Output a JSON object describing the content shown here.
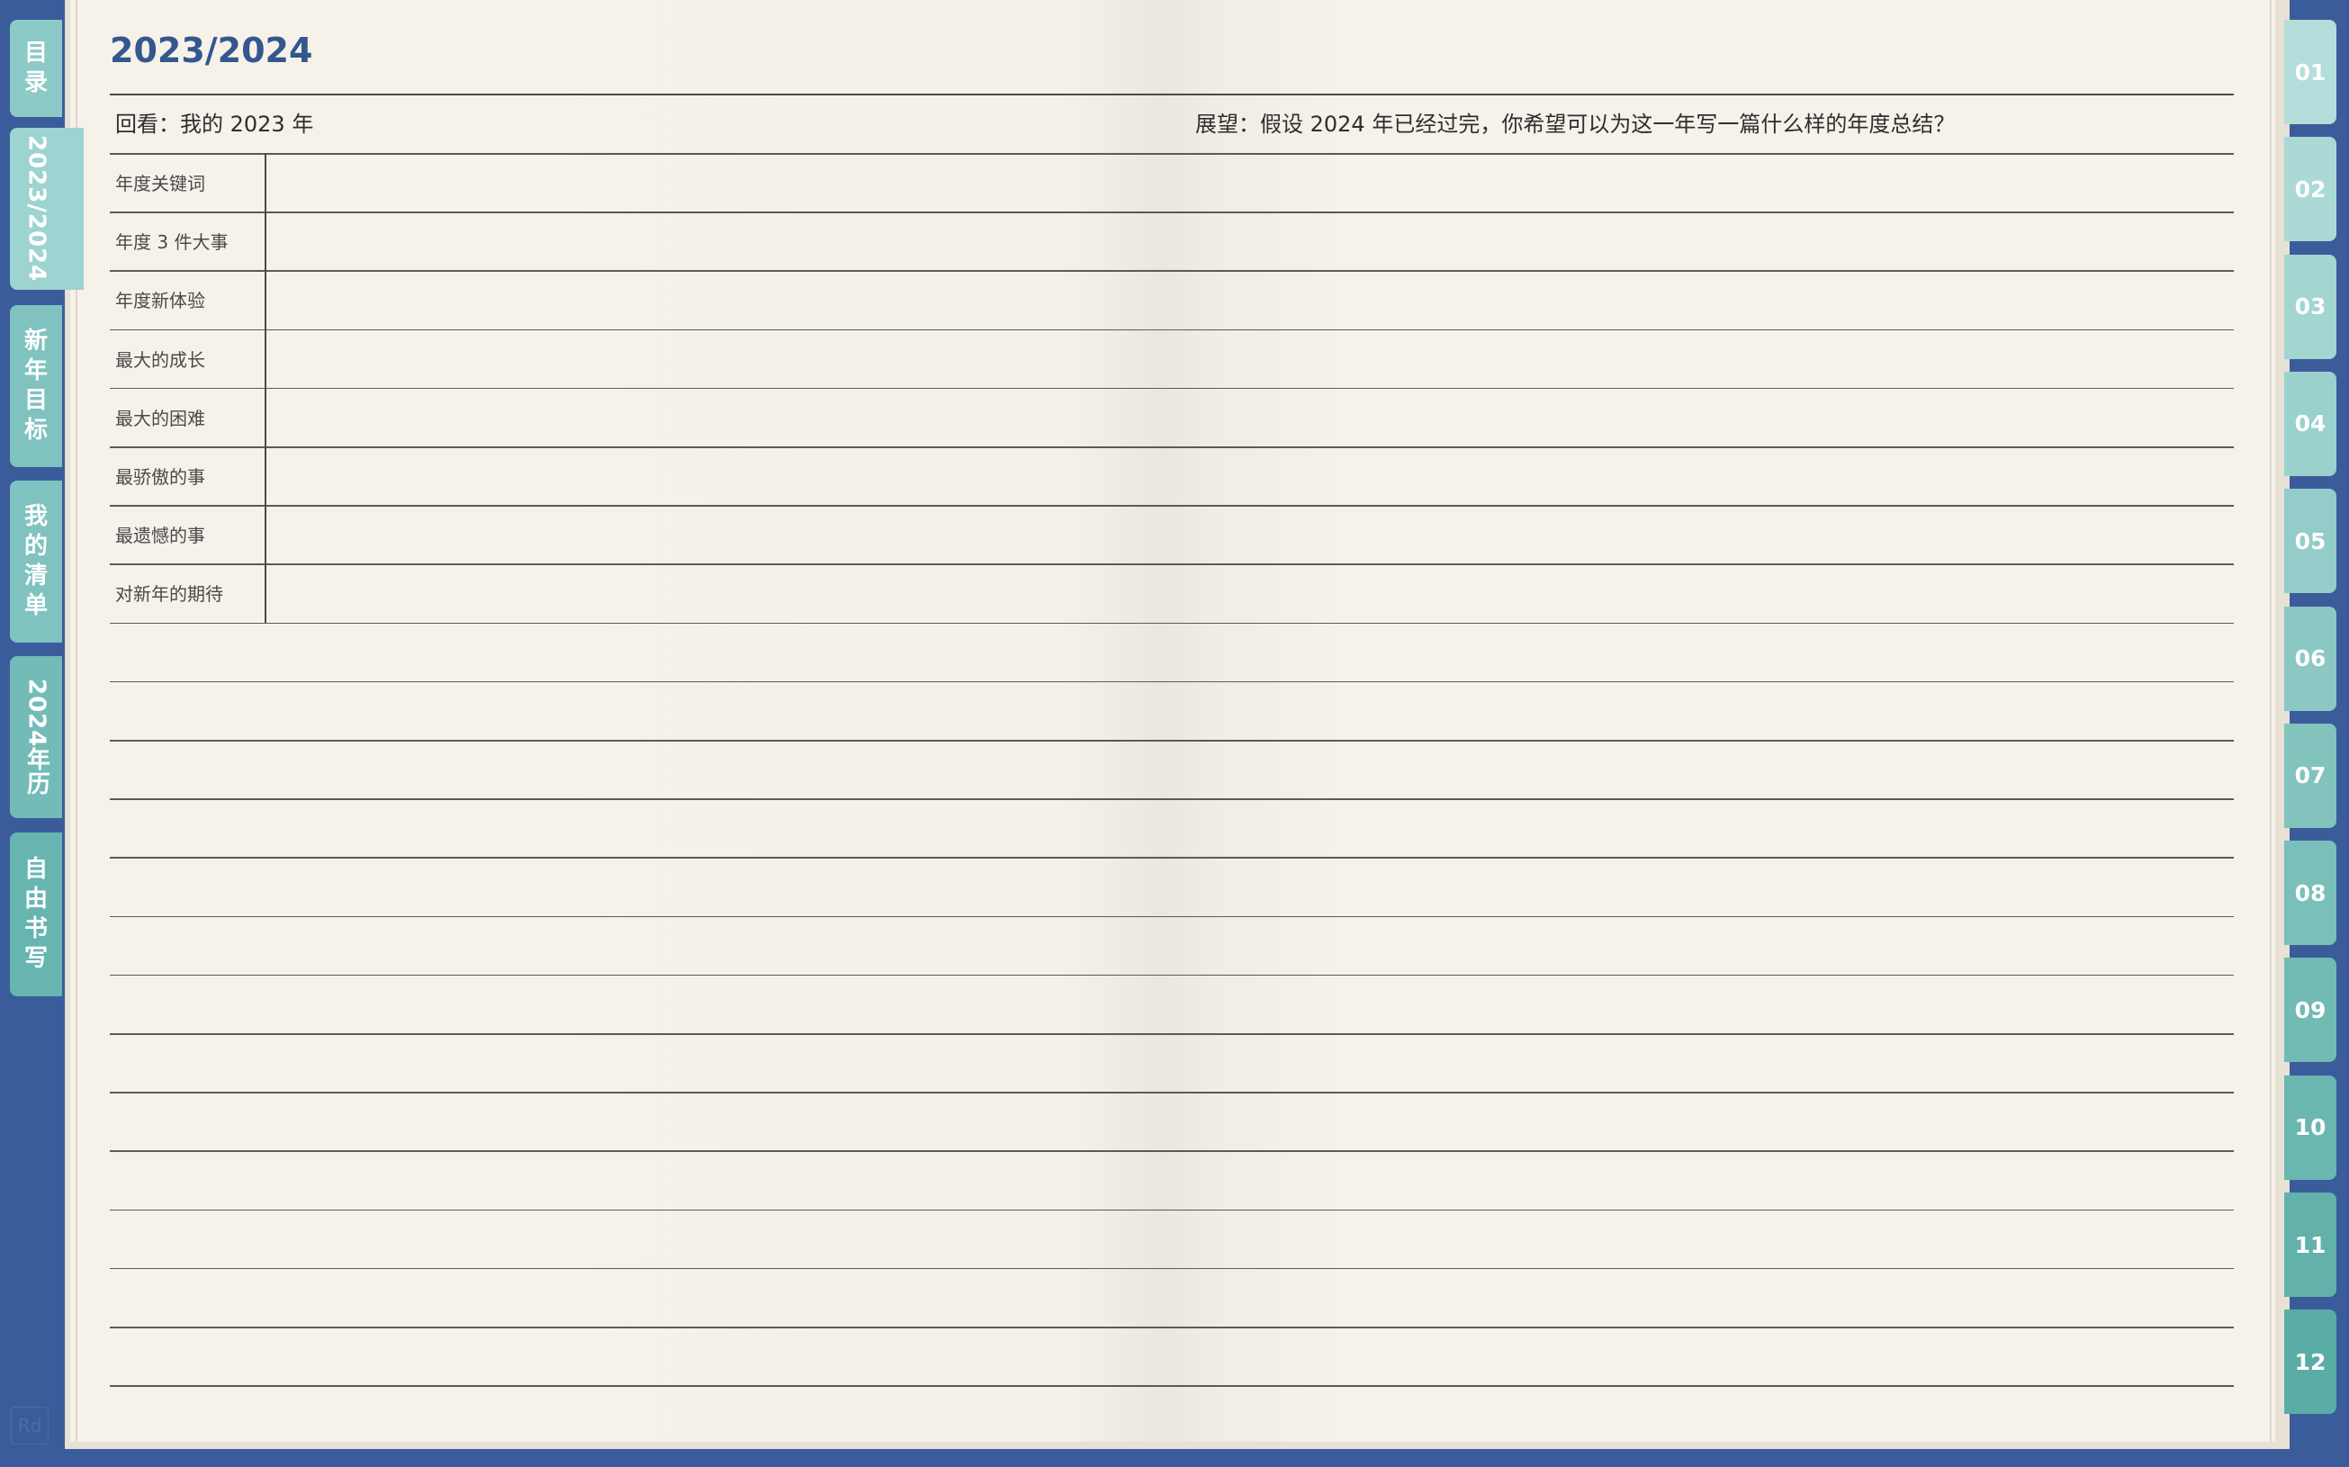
{
  "app": {
    "accent_color": "#3b5c9b",
    "tab_colors": [
      "#7fc2c0",
      "#9dd3d0",
      "#66b5b1"
    ]
  },
  "sidebar": {
    "tabs": [
      {
        "label": "目录",
        "active": false
      },
      {
        "label": "2023/2024",
        "active": true
      },
      {
        "label": "新年目标",
        "active": false
      },
      {
        "label": "我的清单",
        "active": false
      },
      {
        "label": "2024年历",
        "active": false
      },
      {
        "label": "自由书写",
        "active": false
      }
    ]
  },
  "months": {
    "tabs": [
      "01",
      "02",
      "03",
      "04",
      "05",
      "06",
      "07",
      "08",
      "09",
      "10",
      "11",
      "12"
    ]
  },
  "page": {
    "title": "2023/2024",
    "review_header": "回看：我的 2023 年",
    "outlook_header": "展望：假设 2024 年已经过完，你希望可以为这一年写一篇什么样的年度总结？",
    "rows": [
      "年度关键词",
      "年度 3 件大事",
      "年度新体验",
      "最大的成长",
      "最大的困难",
      "最骄傲的事",
      "最遗憾的事",
      "对新年的期待"
    ],
    "blank_line_count": 13
  },
  "watermark": {
    "text": "Rd"
  }
}
